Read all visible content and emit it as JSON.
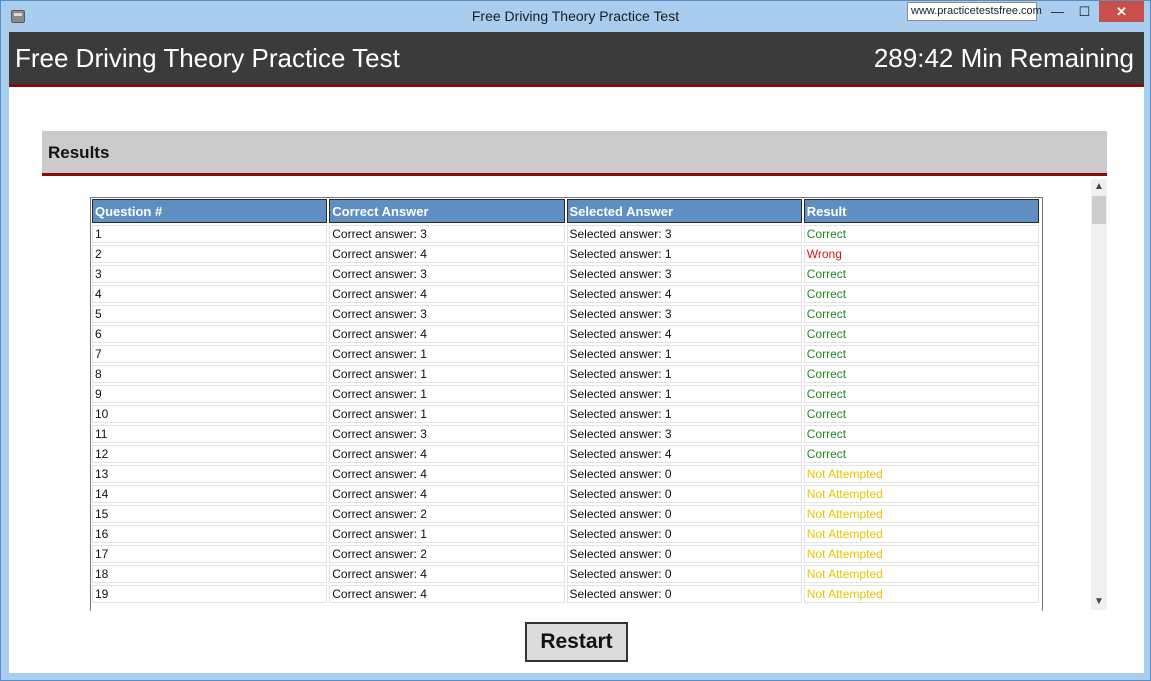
{
  "window": {
    "title": "Free Driving Theory Practice Test",
    "url_tooltip": "www.practicetestsfree.com",
    "min_glyph": "—",
    "max_glyph": "☐",
    "close_glyph": "✕"
  },
  "header": {
    "title": "Free Driving Theory Practice Test",
    "timer": "289:42 Min Remaining"
  },
  "results": {
    "section_title": "Results",
    "columns": [
      "Question #",
      "Correct Answer",
      "Selected Answer",
      "Result"
    ],
    "rows": [
      {
        "q": "1",
        "correct": "Correct answer: 3",
        "selected": "Selected answer: 3",
        "result": "Correct"
      },
      {
        "q": "2",
        "correct": "Correct answer: 4",
        "selected": "Selected answer: 1",
        "result": "Wrong"
      },
      {
        "q": "3",
        "correct": "Correct answer: 3",
        "selected": "Selected answer: 3",
        "result": "Correct"
      },
      {
        "q": "4",
        "correct": "Correct answer: 4",
        "selected": "Selected answer: 4",
        "result": "Correct"
      },
      {
        "q": "5",
        "correct": "Correct answer: 3",
        "selected": "Selected answer: 3",
        "result": "Correct"
      },
      {
        "q": "6",
        "correct": "Correct answer: 4",
        "selected": "Selected answer: 4",
        "result": "Correct"
      },
      {
        "q": "7",
        "correct": "Correct answer: 1",
        "selected": "Selected answer: 1",
        "result": "Correct"
      },
      {
        "q": "8",
        "correct": "Correct answer: 1",
        "selected": "Selected answer: 1",
        "result": "Correct"
      },
      {
        "q": "9",
        "correct": "Correct answer: 1",
        "selected": "Selected answer: 1",
        "result": "Correct"
      },
      {
        "q": "10",
        "correct": "Correct answer: 1",
        "selected": "Selected answer: 1",
        "result": "Correct"
      },
      {
        "q": "11",
        "correct": "Correct answer: 3",
        "selected": "Selected answer: 3",
        "result": "Correct"
      },
      {
        "q": "12",
        "correct": "Correct answer: 4",
        "selected": "Selected answer: 4",
        "result": "Correct"
      },
      {
        "q": "13",
        "correct": "Correct answer: 4",
        "selected": "Selected answer: 0",
        "result": "Not Attempted"
      },
      {
        "q": "14",
        "correct": "Correct answer: 4",
        "selected": "Selected answer: 0",
        "result": "Not Attempted"
      },
      {
        "q": "15",
        "correct": "Correct answer: 2",
        "selected": "Selected answer: 0",
        "result": "Not Attempted"
      },
      {
        "q": "16",
        "correct": "Correct answer: 1",
        "selected": "Selected answer: 0",
        "result": "Not Attempted"
      },
      {
        "q": "17",
        "correct": "Correct answer: 2",
        "selected": "Selected answer: 0",
        "result": "Not Attempted"
      },
      {
        "q": "18",
        "correct": "Correct answer: 4",
        "selected": "Selected answer: 0",
        "result": "Not Attempted"
      },
      {
        "q": "19",
        "correct": "Correct answer: 4",
        "selected": "Selected answer: 0",
        "result": "Not Attempted"
      }
    ]
  },
  "restart_label": "Restart",
  "colors": {
    "correct": "#1c8a1c",
    "wrong": "#d01818",
    "not_attempted": "#e8c400",
    "accent": "#8b0a0a",
    "header_bg": "#3b3b3b",
    "table_header_bg": "#5f8fc2"
  }
}
